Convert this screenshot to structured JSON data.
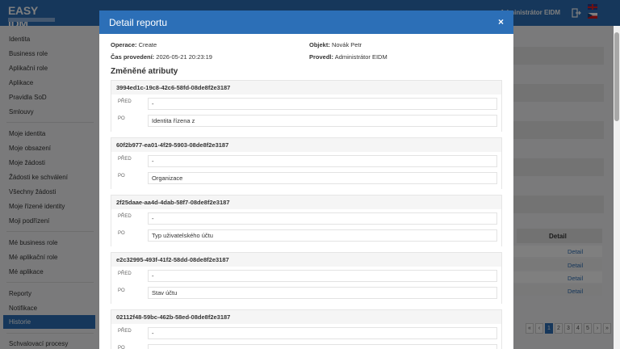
{
  "app": {
    "logo_text": "EASY IDM",
    "user": "Administrátor EIDM"
  },
  "sidebar": {
    "items": [
      {
        "label": "Identita"
      },
      {
        "label": "Business role"
      },
      {
        "label": "Aplikační role"
      },
      {
        "label": "Aplikace"
      },
      {
        "label": "Pravidla SoD"
      },
      {
        "label": "Smlouvy"
      },
      {
        "label": "Moje identita"
      },
      {
        "label": "Moje obsazení"
      },
      {
        "label": "Moje žádosti"
      },
      {
        "label": "Žádosti ke schválení"
      },
      {
        "label": "Všechny žádosti"
      },
      {
        "label": "Moje řízené identity"
      },
      {
        "label": "Moji podřízení"
      },
      {
        "label": "Mé business role"
      },
      {
        "label": "Mé aplikační role"
      },
      {
        "label": "Mé aplikace"
      },
      {
        "label": "Reporty"
      },
      {
        "label": "Notifikace"
      },
      {
        "label": "Historie"
      },
      {
        "label": "Schvalovací procesy"
      }
    ],
    "active_index": 18
  },
  "background": {
    "table_header": "Detail",
    "links": [
      "Detail",
      "Detail",
      "Detail",
      "Detail"
    ],
    "pager": [
      "«",
      "‹",
      "1",
      "2",
      "3",
      "4",
      "5",
      "›",
      "»"
    ],
    "pager_current": "1"
  },
  "modal": {
    "title": "Detail reportu",
    "close": "×",
    "operation_label": "Operace:",
    "operation_value": "Create",
    "time_label": "Čas provedení:",
    "time_value": "2026-05-21 20:23:19",
    "object_label": "Objekt:",
    "object_value": "Novák Petr",
    "performed_label": "Provedl:",
    "performed_value": "Administrátor EIDM",
    "changed_title": "Změněné atributy",
    "before_label": "PŘED",
    "after_label": "PO",
    "attributes": [
      {
        "id": "3994ed1c-19c8-42c6-58fd-08de8f2e3187",
        "before": "-",
        "after": "Identita řízena z"
      },
      {
        "id": "60f2b977-ea01-4f29-5903-08de8f2e3187",
        "before": "-",
        "after": "Organizace"
      },
      {
        "id": "2f25daae-aa4d-4dab-58f7-08de8f2e3187",
        "before": "-",
        "after": "Typ uživatelského účtu"
      },
      {
        "id": "e2c32995-493f-41f2-58dd-08de8f2e3187",
        "before": "-",
        "after": "Stav účtu"
      },
      {
        "id": "02112f48-59bc-462b-58ed-08de8f2e3187",
        "before": "-",
        "after": ""
      }
    ]
  },
  "colors": {
    "primary": "#2c6fb7",
    "active_sidebar": "#2c6fb7"
  }
}
